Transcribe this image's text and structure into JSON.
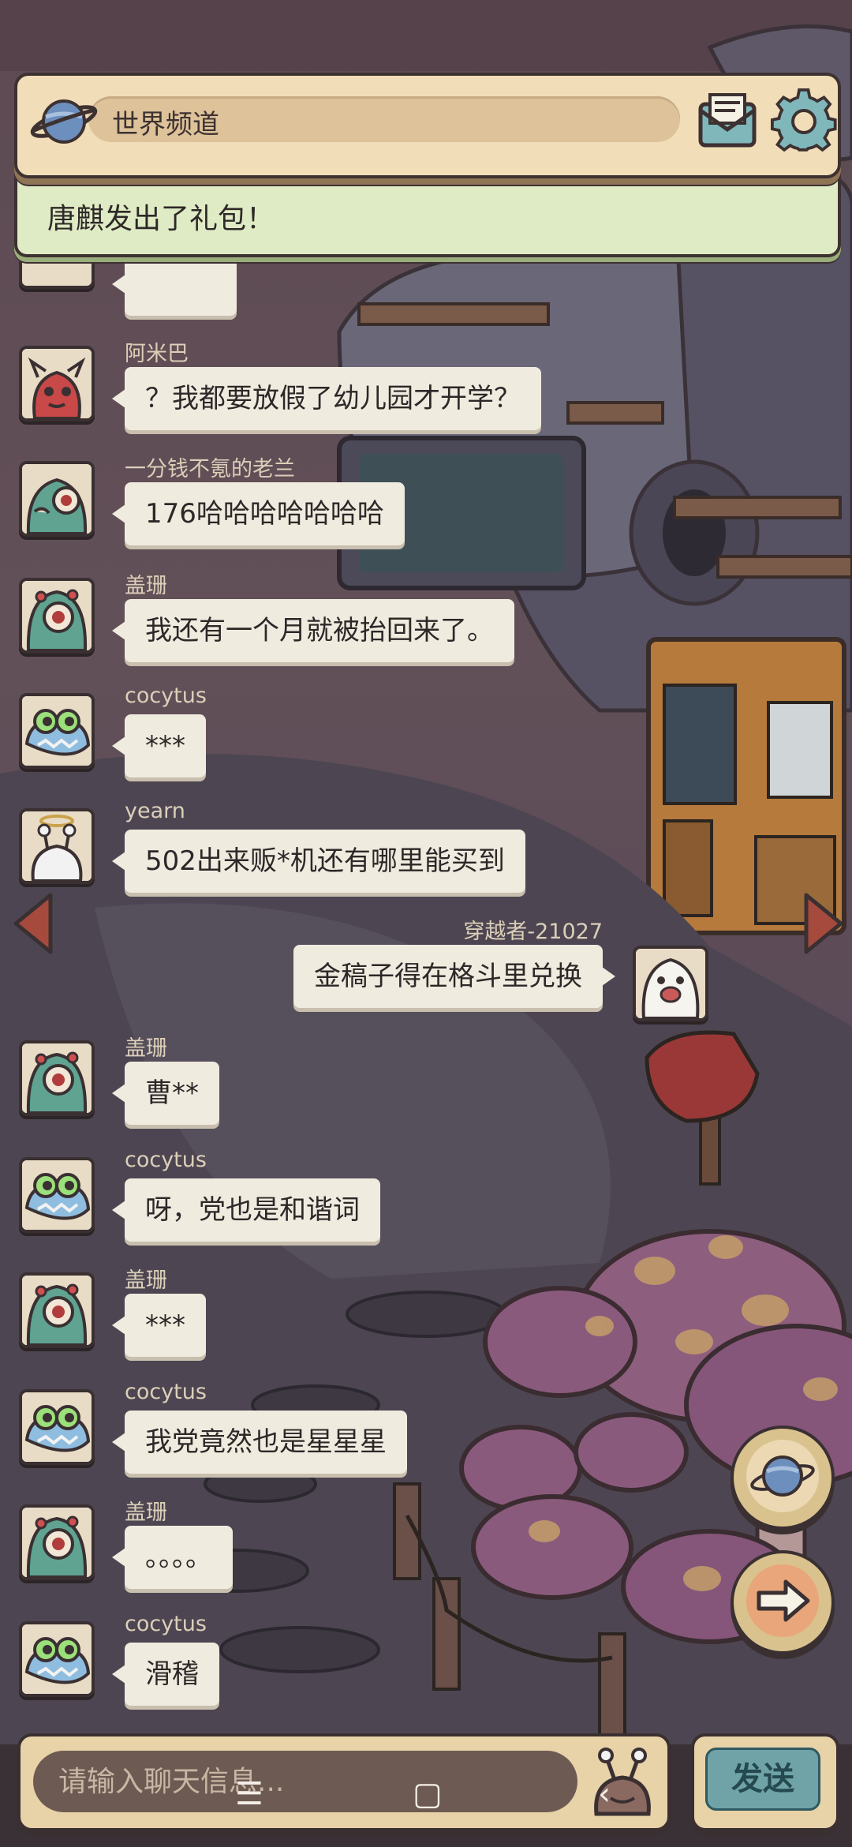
{
  "header": {
    "channel": "世界频道"
  },
  "notice": {
    "text": "唐麒发出了礼包！"
  },
  "messages": [
    {
      "user": "阿米巴",
      "text": "？我都要放假了幼儿园才开学？"
    },
    {
      "user": "一分钱不氪的老兰",
      "text": "176哈哈哈哈哈哈哈"
    },
    {
      "user": "盖珊",
      "text": "我还有一个月就被抬回来了。"
    },
    {
      "user": "cocytus",
      "text": "***"
    },
    {
      "user": "yearn",
      "text": "502出来贩*机还有哪里能买到"
    },
    {
      "user": "穿越者-21027",
      "text": "金稿子得在格斗里兑换"
    },
    {
      "user": "盖珊",
      "text": "曹**"
    },
    {
      "user": "cocytus",
      "text": "呀，党也是和谐词"
    },
    {
      "user": "盖珊",
      "text": "***"
    },
    {
      "user": "cocytus",
      "text": "我党竟然也是星星星"
    },
    {
      "user": "盖珊",
      "text": "。。。。"
    },
    {
      "user": "cocytus",
      "text": "滑稽"
    }
  ],
  "input": {
    "placeholder": "请输入聊天信息..."
  },
  "send": {
    "label": "发送"
  },
  "nav": {
    "menu": "☰",
    "home": "▢",
    "back": "‹"
  }
}
